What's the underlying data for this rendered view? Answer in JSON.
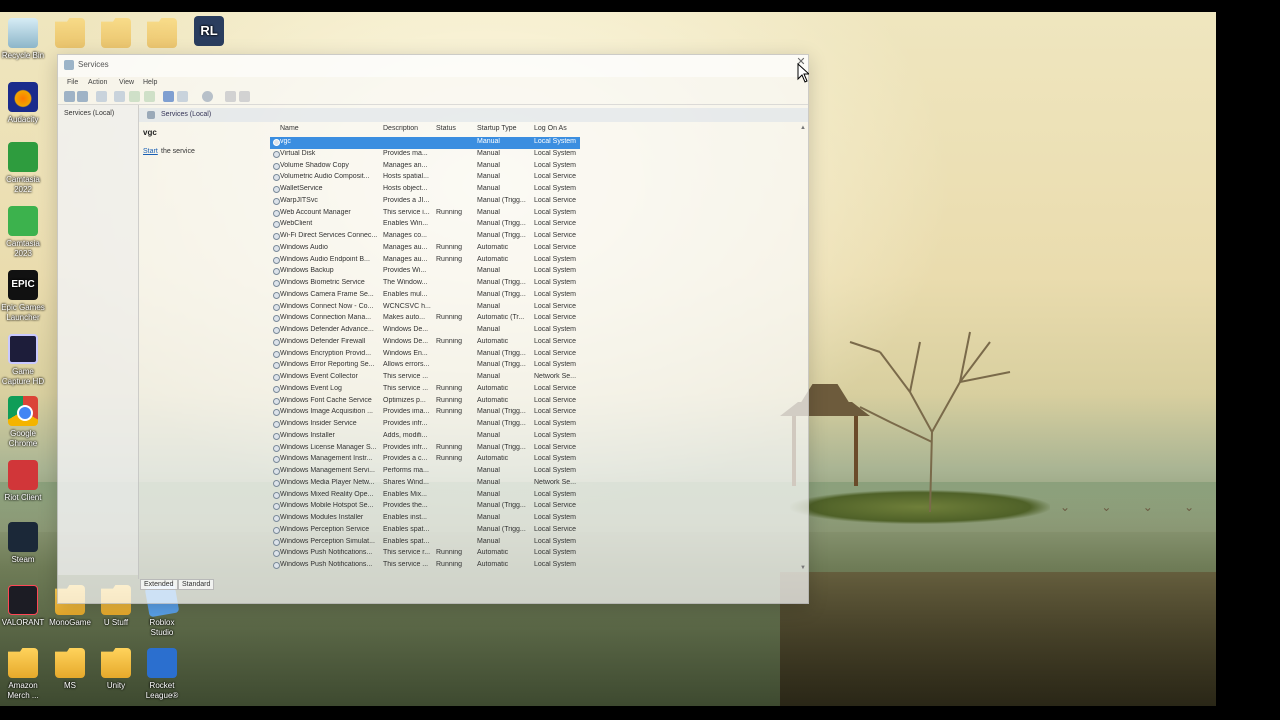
{
  "desktop": {
    "icons": [
      {
        "label": "Recycle Bin",
        "icon": "recycle-bin-icon"
      },
      {
        "label": "Audacity",
        "icon": "audacity-icon"
      },
      {
        "label": "Camtasia 2022",
        "icon": "camtasia-icon"
      },
      {
        "label": "Camtasia 2023",
        "icon": "camtasia-icon"
      },
      {
        "label": "Epic Games Launcher",
        "icon": "epic-games-icon"
      },
      {
        "label": "Game Capture HD",
        "icon": "game-capture-icon"
      },
      {
        "label": "Google Chrome",
        "icon": "chrome-icon"
      },
      {
        "label": "Riot Client",
        "icon": "riot-client-icon"
      },
      {
        "label": "Steam",
        "icon": "steam-icon"
      },
      {
        "label": "VALORANT",
        "icon": "valorant-icon"
      },
      {
        "label": "Amazon Merch ...",
        "icon": "folder-icon"
      },
      {
        "label": "MonoGame",
        "icon": "folder-icon"
      },
      {
        "label": "U Stuff",
        "icon": "folder-icon"
      },
      {
        "label": "Roblox Studio",
        "icon": "roblox-studio-icon"
      },
      {
        "label": "MS",
        "icon": "folder-icon"
      },
      {
        "label": "Unity",
        "icon": "folder-icon"
      },
      {
        "label": "Rocket League®",
        "icon": "rocket-league-icon"
      }
    ],
    "epic_label": "EPIC"
  },
  "window": {
    "title": "Services",
    "menu": [
      "File",
      "Action",
      "View",
      "Help"
    ],
    "tree_node": "Services (Local)",
    "header_title": "Services (Local)",
    "selected_service": "vgc",
    "start_link": "Start",
    "start_rest": "the service",
    "tabs": [
      "Extended",
      "Standard"
    ],
    "close_glyph": "✕"
  },
  "columns": [
    "Name",
    "Description",
    "Status",
    "Startup Type",
    "Log On As"
  ],
  "services": [
    {
      "name": "vgc",
      "desc": "",
      "status": "",
      "startup": "Manual",
      "logon": "Local System",
      "selected": true
    },
    {
      "name": "Virtual Disk",
      "desc": "Provides ma...",
      "status": "",
      "startup": "Manual",
      "logon": "Local System"
    },
    {
      "name": "Volume Shadow Copy",
      "desc": "Manages an...",
      "status": "",
      "startup": "Manual",
      "logon": "Local System"
    },
    {
      "name": "Volumetric Audio Composit...",
      "desc": "Hosts spatial...",
      "status": "",
      "startup": "Manual",
      "logon": "Local Service"
    },
    {
      "name": "WalletService",
      "desc": "Hosts object...",
      "status": "",
      "startup": "Manual",
      "logon": "Local System"
    },
    {
      "name": "WarpJITSvc",
      "desc": "Provides a JI...",
      "status": "",
      "startup": "Manual (Trigg...",
      "logon": "Local Service"
    },
    {
      "name": "Web Account Manager",
      "desc": "This service i...",
      "status": "Running",
      "startup": "Manual",
      "logon": "Local System"
    },
    {
      "name": "WebClient",
      "desc": "Enables Win...",
      "status": "",
      "startup": "Manual (Trigg...",
      "logon": "Local Service"
    },
    {
      "name": "Wi-Fi Direct Services Connec...",
      "desc": "Manages co...",
      "status": "",
      "startup": "Manual (Trigg...",
      "logon": "Local Service"
    },
    {
      "name": "Windows Audio",
      "desc": "Manages au...",
      "status": "Running",
      "startup": "Automatic",
      "logon": "Local Service"
    },
    {
      "name": "Windows Audio Endpoint B...",
      "desc": "Manages au...",
      "status": "Running",
      "startup": "Automatic",
      "logon": "Local System"
    },
    {
      "name": "Windows Backup",
      "desc": "Provides Wi...",
      "status": "",
      "startup": "Manual",
      "logon": "Local System"
    },
    {
      "name": "Windows Biometric Service",
      "desc": "The Window...",
      "status": "",
      "startup": "Manual (Trigg...",
      "logon": "Local System"
    },
    {
      "name": "Windows Camera Frame Se...",
      "desc": "Enables mul...",
      "status": "",
      "startup": "Manual (Trigg...",
      "logon": "Local System"
    },
    {
      "name": "Windows Connect Now - Co...",
      "desc": "WCNCSVC h...",
      "status": "",
      "startup": "Manual",
      "logon": "Local Service"
    },
    {
      "name": "Windows Connection Mana...",
      "desc": "Makes auto...",
      "status": "Running",
      "startup": "Automatic (Tr...",
      "logon": "Local Service"
    },
    {
      "name": "Windows Defender Advance...",
      "desc": "Windows De...",
      "status": "",
      "startup": "Manual",
      "logon": "Local System"
    },
    {
      "name": "Windows Defender Firewall",
      "desc": "Windows De...",
      "status": "Running",
      "startup": "Automatic",
      "logon": "Local Service"
    },
    {
      "name": "Windows Encryption Provid...",
      "desc": "Windows En...",
      "status": "",
      "startup": "Manual (Trigg...",
      "logon": "Local Service"
    },
    {
      "name": "Windows Error Reporting Se...",
      "desc": "Allows errors...",
      "status": "",
      "startup": "Manual (Trigg...",
      "logon": "Local System"
    },
    {
      "name": "Windows Event Collector",
      "desc": "This service ...",
      "status": "",
      "startup": "Manual",
      "logon": "Network Se..."
    },
    {
      "name": "Windows Event Log",
      "desc": "This service ...",
      "status": "Running",
      "startup": "Automatic",
      "logon": "Local Service"
    },
    {
      "name": "Windows Font Cache Service",
      "desc": "Optimizes p...",
      "status": "Running",
      "startup": "Automatic",
      "logon": "Local Service"
    },
    {
      "name": "Windows Image Acquisition ...",
      "desc": "Provides ima...",
      "status": "Running",
      "startup": "Manual (Trigg...",
      "logon": "Local Service"
    },
    {
      "name": "Windows Insider Service",
      "desc": "Provides infr...",
      "status": "",
      "startup": "Manual (Trigg...",
      "logon": "Local System"
    },
    {
      "name": "Windows Installer",
      "desc": "Adds, modifi...",
      "status": "",
      "startup": "Manual",
      "logon": "Local System"
    },
    {
      "name": "Windows License Manager S...",
      "desc": "Provides infr...",
      "status": "Running",
      "startup": "Manual (Trigg...",
      "logon": "Local Service"
    },
    {
      "name": "Windows Management Instr...",
      "desc": "Provides a c...",
      "status": "Running",
      "startup": "Automatic",
      "logon": "Local System"
    },
    {
      "name": "Windows Management Servi...",
      "desc": "Performs ma...",
      "status": "",
      "startup": "Manual",
      "logon": "Local System"
    },
    {
      "name": "Windows Media Player Netw...",
      "desc": "Shares Wind...",
      "status": "",
      "startup": "Manual",
      "logon": "Network Se..."
    },
    {
      "name": "Windows Mixed Reality Ope...",
      "desc": "Enables Mix...",
      "status": "",
      "startup": "Manual",
      "logon": "Local System"
    },
    {
      "name": "Windows Mobile Hotspot Se...",
      "desc": "Provides the...",
      "status": "",
      "startup": "Manual (Trigg...",
      "logon": "Local Service"
    },
    {
      "name": "Windows Modules Installer",
      "desc": "Enables inst...",
      "status": "",
      "startup": "Manual",
      "logon": "Local System"
    },
    {
      "name": "Windows Perception Service",
      "desc": "Enables spat...",
      "status": "",
      "startup": "Manual (Trigg...",
      "logon": "Local Service"
    },
    {
      "name": "Windows Perception Simulat...",
      "desc": "Enables spat...",
      "status": "",
      "startup": "Manual",
      "logon": "Local System"
    },
    {
      "name": "Windows Push Notifications...",
      "desc": "This service r...",
      "status": "Running",
      "startup": "Automatic",
      "logon": "Local System"
    },
    {
      "name": "Windows Push Notifications...",
      "desc": "This service ...",
      "status": "Running",
      "startup": "Automatic",
      "logon": "Local System"
    }
  ]
}
